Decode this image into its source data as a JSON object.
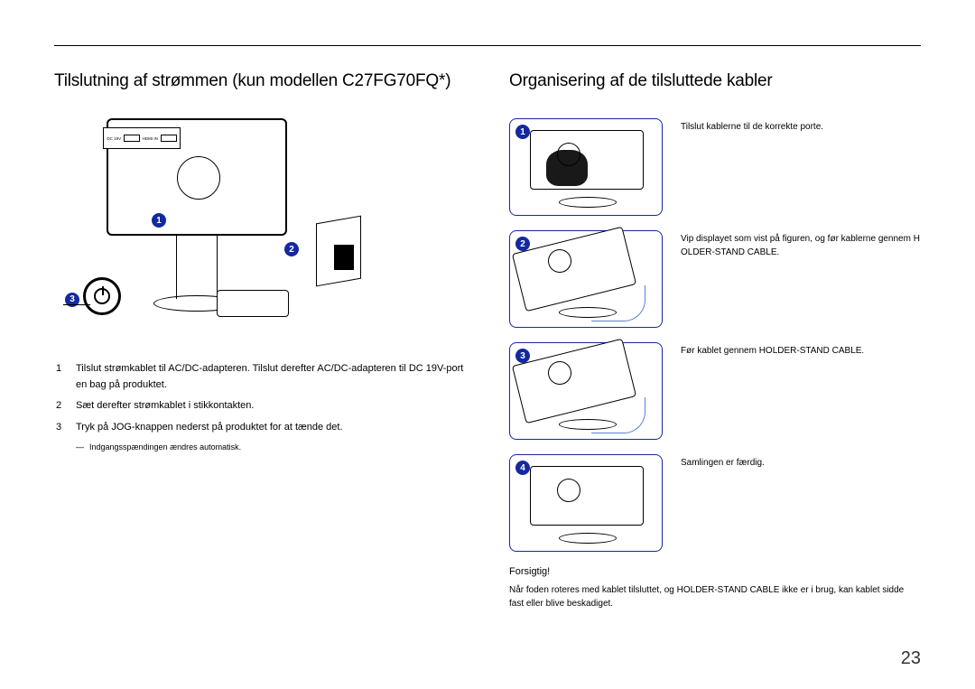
{
  "page_number": "23",
  "left": {
    "heading": "Tilslutning af strømmen (kun modellen C27FG70FQ*)",
    "port_labels": {
      "dc": "DC 19V",
      "hdmi": "HDMI IN"
    },
    "badges": {
      "b1": "1",
      "b2": "2",
      "b3": "3"
    },
    "instructions": [
      {
        "num": "1",
        "text": "Tilslut strømkablet til AC/DC-adapteren. Tilslut derefter AC/DC-adapteren til DC 19V-porten bag på produktet."
      },
      {
        "num": "2",
        "text": "Sæt derefter strømkablet i stikkontakten."
      },
      {
        "num": "3",
        "text": "Tryk på JOG-knappen nederst på produktet for at tænde det."
      }
    ],
    "footnote": "Indgangsspændingen ændres automatisk.",
    "small_code": "DC 19V"
  },
  "right": {
    "heading": "Organisering af de tilsluttede kabler",
    "steps": [
      {
        "badge": "1",
        "text": "Tilslut kablerne til de korrekte porte."
      },
      {
        "badge": "2",
        "text": "Vip displayet som vist på figuren, og før kablerne gennem HOLDER-STAND CABLE."
      },
      {
        "badge": "3",
        "text": "Før kablet gennem HOLDER-STAND CABLE."
      },
      {
        "badge": "4",
        "text": "Samlingen er færdig."
      }
    ],
    "caution_title": "Forsigtig!",
    "caution_text": "Når foden roteres med kablet tilsluttet, og HOLDER-STAND CABLE ikke er i brug, kan kablet sidde fast eller blive beskadiget."
  }
}
